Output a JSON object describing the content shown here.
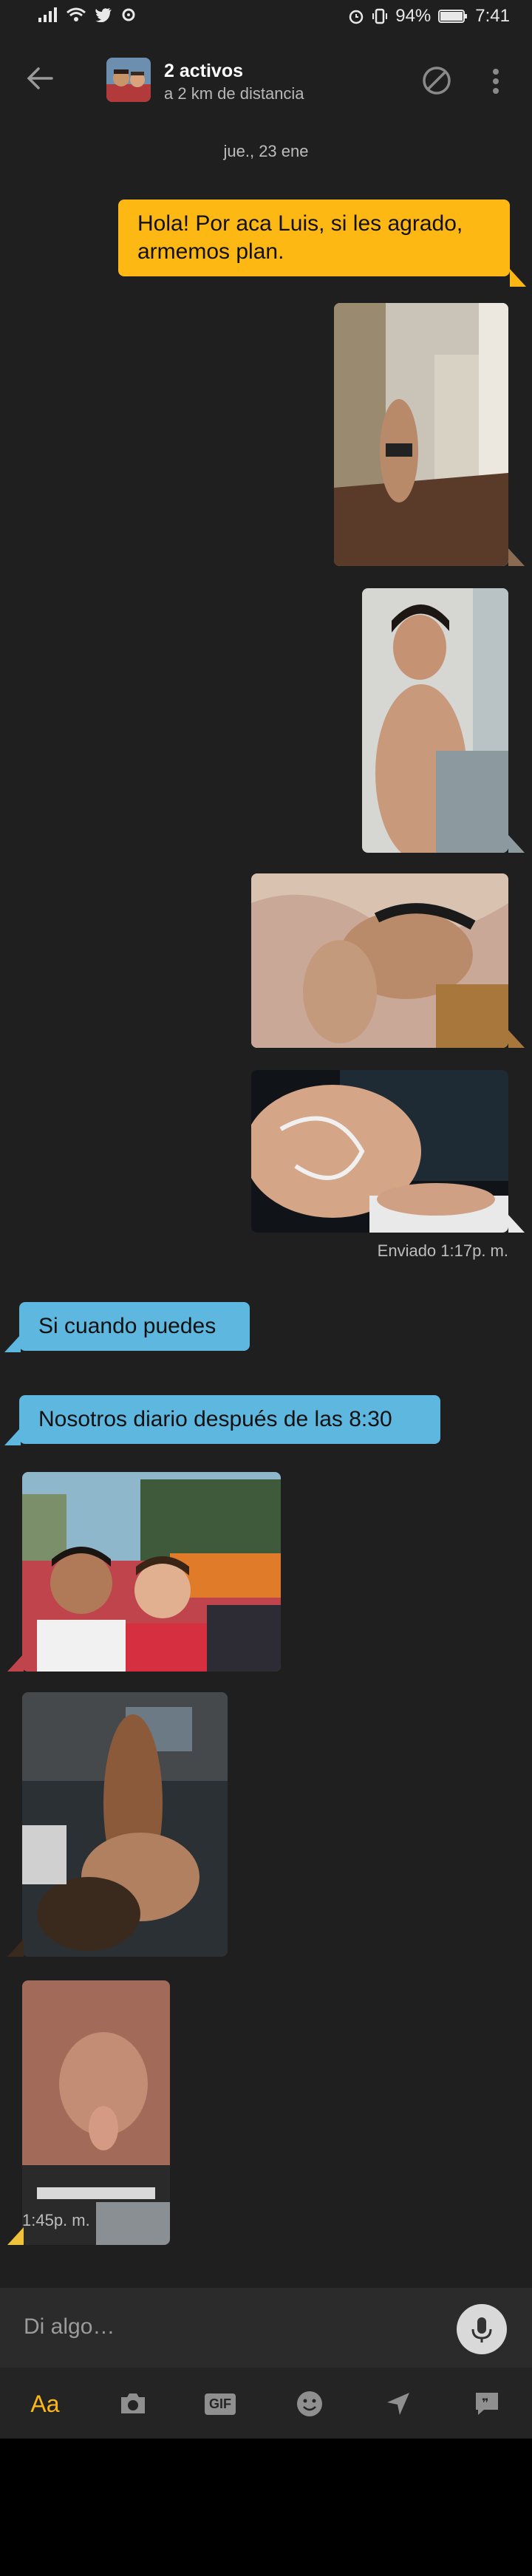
{
  "status_bar": {
    "battery_percent": "94%",
    "time": "7:41"
  },
  "header": {
    "title": "2 activos",
    "subtitle": "a 2 km de distancia"
  },
  "chat": {
    "date_separator": "jue., 23 ene",
    "messages": [
      {
        "from": "me",
        "type": "text",
        "text": "Hola! Por aca Luis, si les agrado, armemos plan."
      },
      {
        "from": "me",
        "type": "photo"
      },
      {
        "from": "me",
        "type": "photo"
      },
      {
        "from": "me",
        "type": "photo"
      },
      {
        "from": "me",
        "type": "photo"
      },
      {
        "from": "them",
        "type": "text",
        "text": "Si cuando puedes"
      },
      {
        "from": "them",
        "type": "text",
        "text": "Nosotros diario después de las 8:30"
      },
      {
        "from": "them",
        "type": "photo"
      },
      {
        "from": "them",
        "type": "photo"
      },
      {
        "from": "them",
        "type": "photo"
      }
    ],
    "sent_status": "Enviado  1:17p. m.",
    "received_time": "1:45p. m."
  },
  "composer": {
    "placeholder": "Di algo…"
  },
  "toolbar": {
    "text_tool_label": "Aa",
    "gif_label": "GIF"
  },
  "colors": {
    "background": "#1f1f20",
    "outgoing_bubble": "#fdb814",
    "incoming_bubble": "#5db7de",
    "accent": "#fdb814"
  }
}
